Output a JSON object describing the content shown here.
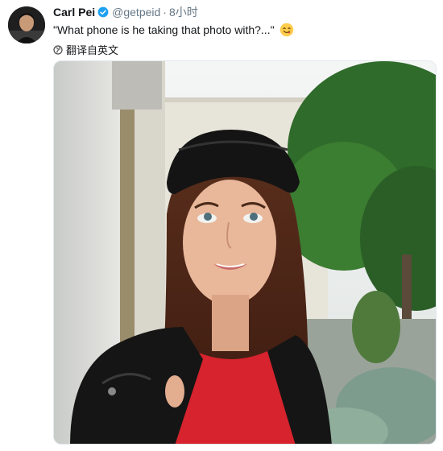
{
  "tweet": {
    "author_name": "Carl Pei",
    "handle": "@getpeid",
    "separator": "·",
    "time": "8小时",
    "text": "\"What phone is he taking that photo with?...\"",
    "translate_label": "翻译自英文"
  },
  "icons": {
    "verified": "verified-badge-icon",
    "emoji": "face-savoring-food-emoji",
    "translate": "globe-icon"
  },
  "colors": {
    "verified_blue": "#1da1f2",
    "muted_text": "#657786"
  }
}
